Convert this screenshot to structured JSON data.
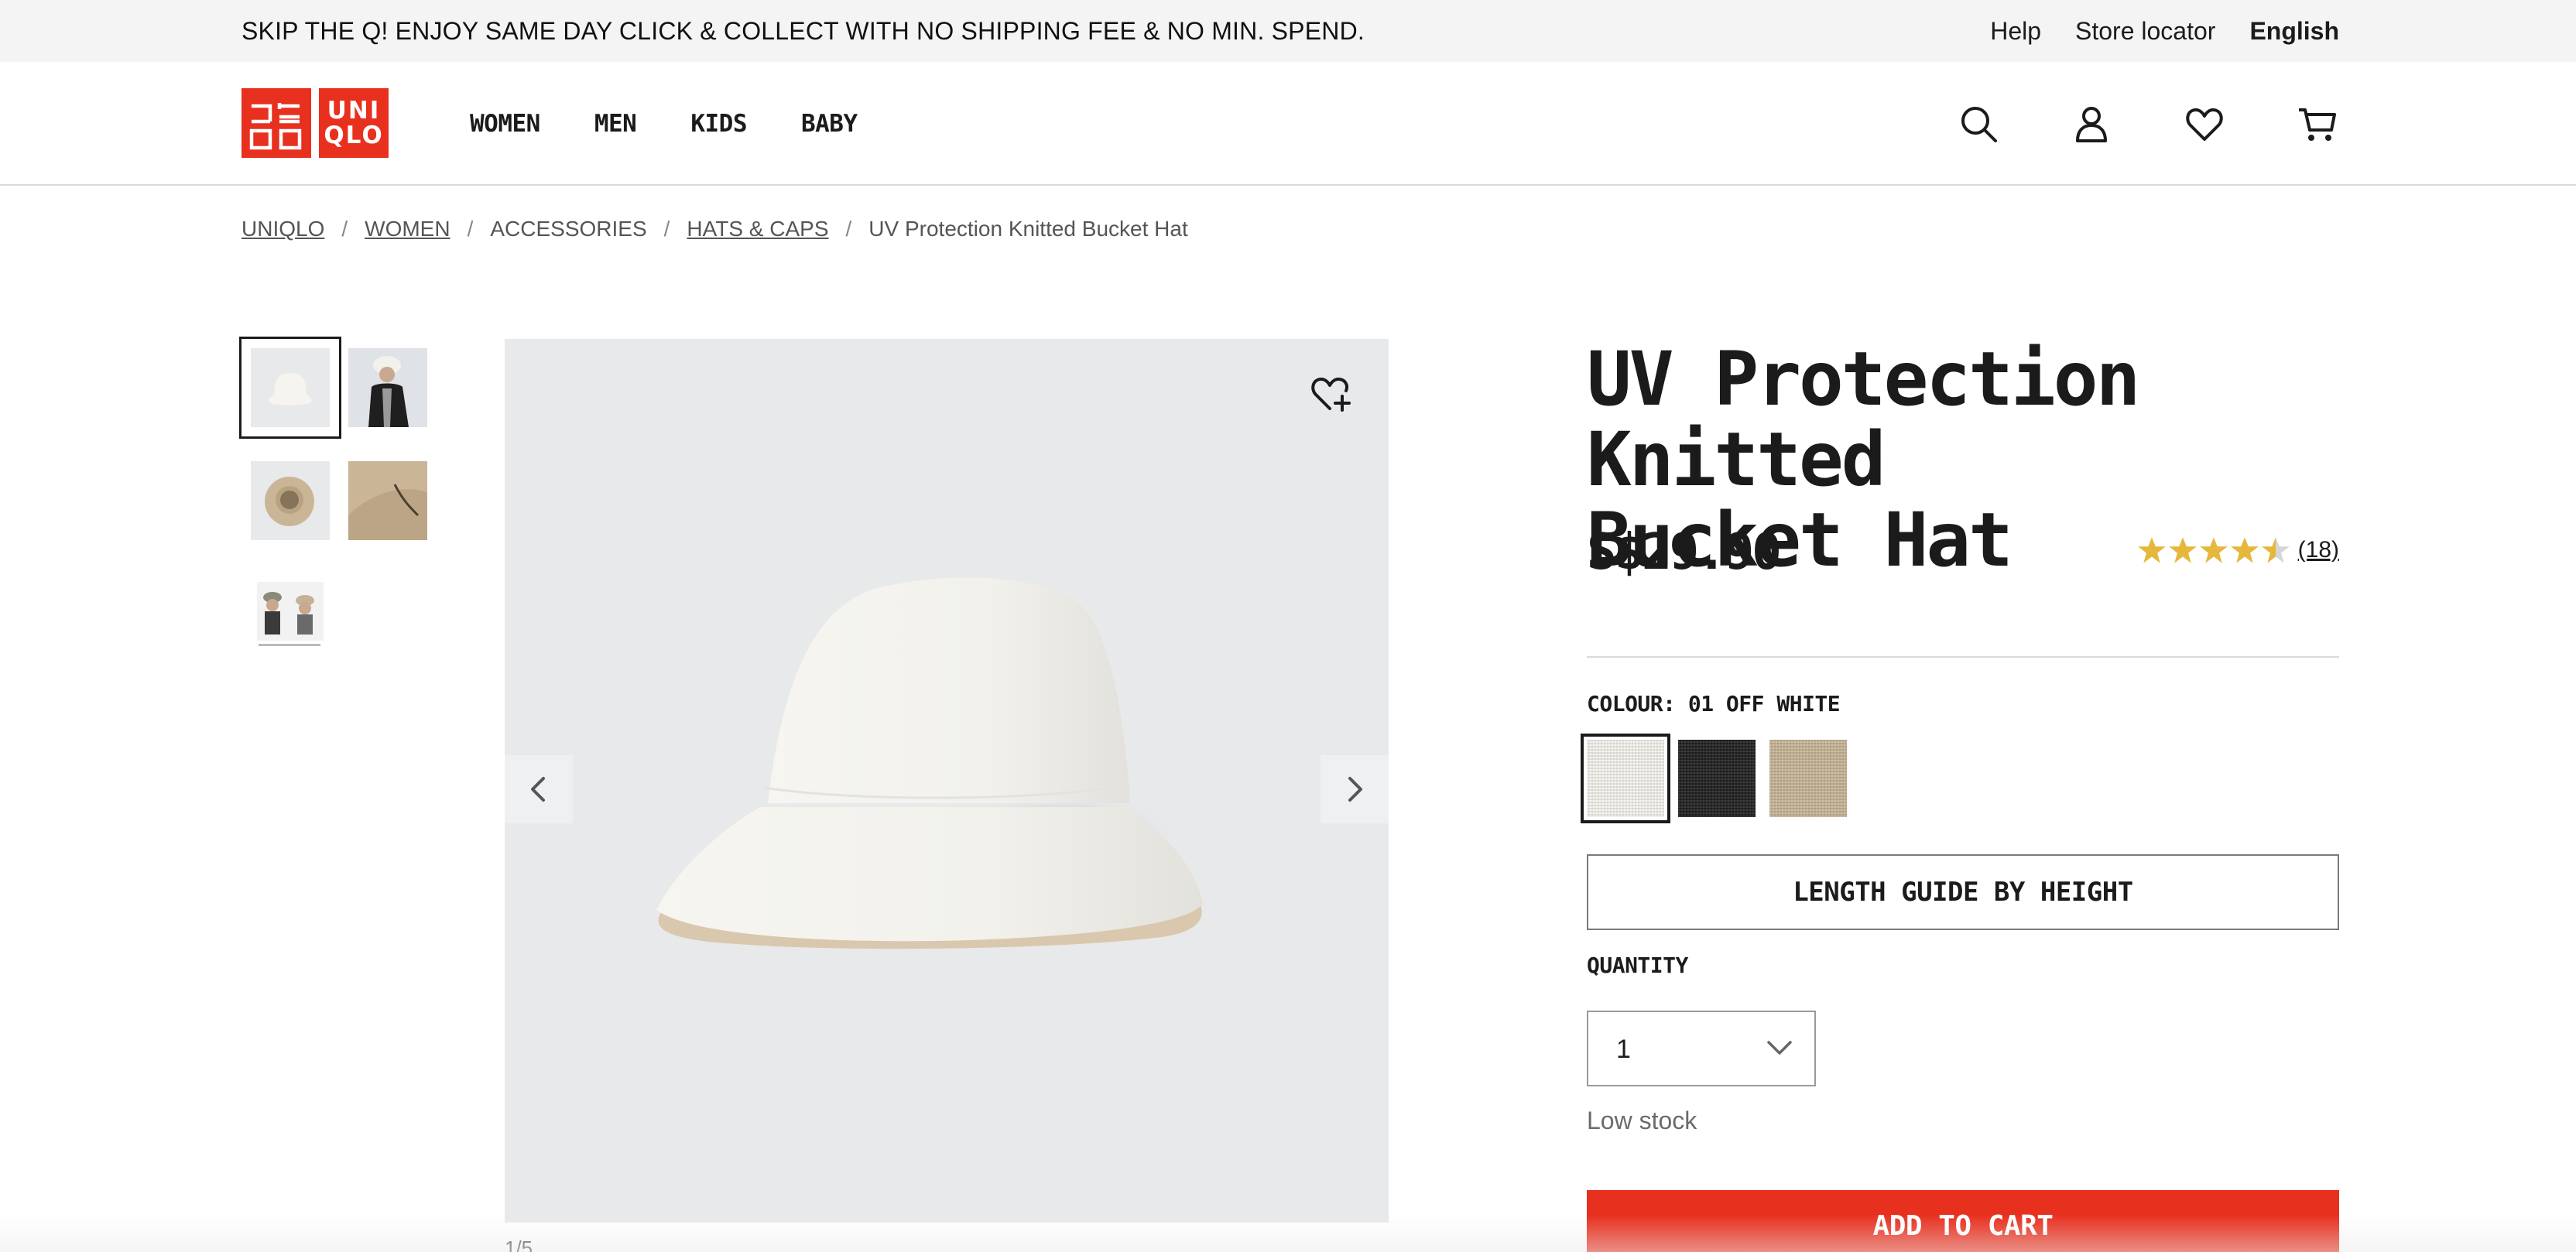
{
  "promo": {
    "text": "SKIP THE Q! ENJOY SAME DAY CLICK & COLLECT WITH NO SHIPPING FEE & NO MIN. SPEND.",
    "links": {
      "help": "Help",
      "store_locator": "Store locator",
      "language": "English"
    }
  },
  "header": {
    "logo_top": "UNI",
    "logo_bottom": "QLO",
    "nav": [
      "WOMEN",
      "MEN",
      "KIDS",
      "BABY"
    ],
    "icons": [
      "search-icon",
      "account-icon",
      "wishlist-icon",
      "cart-icon"
    ]
  },
  "breadcrumb": [
    "UNIQLO",
    "WOMEN",
    "ACCESSORIES",
    "HATS & CAPS",
    "UV Protection Knitted Bucket Hat"
  ],
  "gallery": {
    "thumbnail_count": 5,
    "active_index": 0,
    "counter": "1/5"
  },
  "product": {
    "title_line1": "UV Protection Knitted",
    "title_line2": "Bucket Hat",
    "price": "S$29.90",
    "rating": 4.5,
    "review_count": "(18)",
    "colour_label": "COLOUR: 01 OFF WHITE",
    "colours": [
      "#f6f4ef",
      "#1f1f1f",
      "#c9b697"
    ],
    "length_guide_label": "LENGTH GUIDE BY HEIGHT",
    "quantity_label": "QUANTITY",
    "quantity_value": "1",
    "stock_status": "Low stock",
    "add_to_cart_label": "ADD TO CART"
  },
  "colors": {
    "brand_red": "#e8301f",
    "star_gold": "#e5b73b"
  }
}
